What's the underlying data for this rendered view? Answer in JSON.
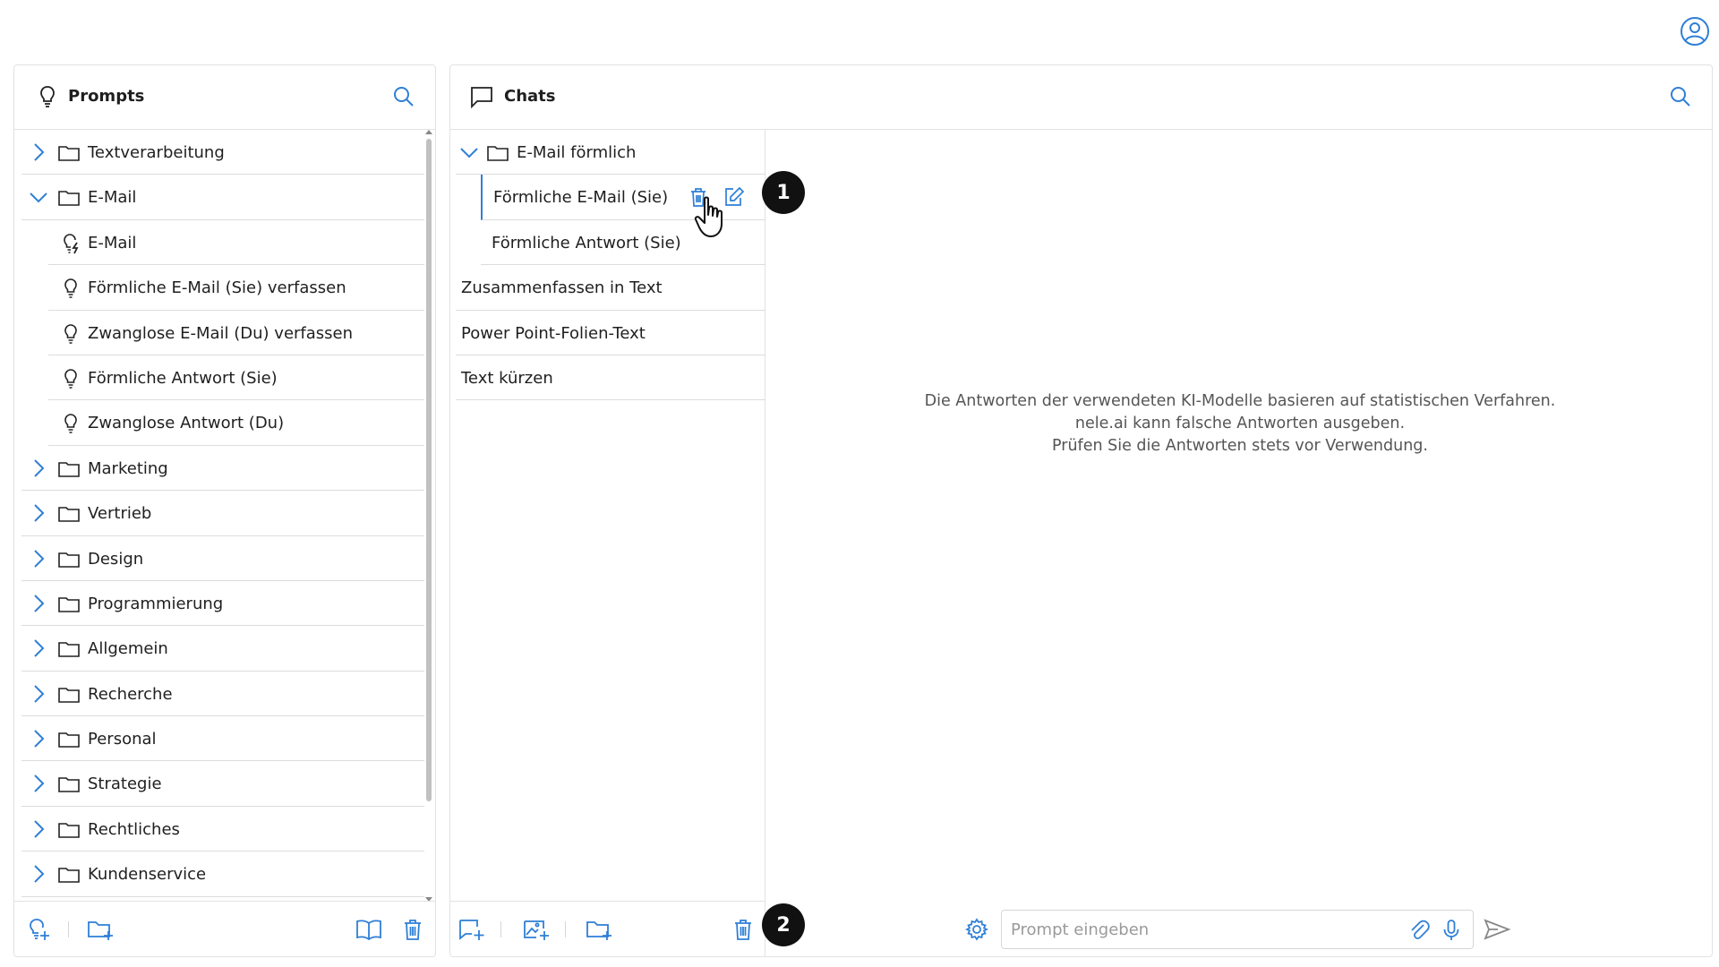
{
  "colors": {
    "accent": "#2f7fd6",
    "text": "#1f1f1f",
    "border": "#e2e2e2",
    "muted": "#555555"
  },
  "prompts": {
    "title": "Prompts",
    "tree": [
      {
        "label": "Textverarbeitung",
        "type": "folder",
        "expanded": false
      },
      {
        "label": "E-Mail",
        "type": "folder",
        "expanded": true
      },
      {
        "label": "E-Mail",
        "type": "prompt-special"
      },
      {
        "label": "Förmliche E-Mail (Sie) verfassen",
        "type": "prompt"
      },
      {
        "label": "Zwanglose E-Mail (Du) verfassen",
        "type": "prompt"
      },
      {
        "label": "Förmliche Antwort (Sie)",
        "type": "prompt"
      },
      {
        "label": "Zwanglose Antwort (Du)",
        "type": "prompt"
      },
      {
        "label": "Marketing",
        "type": "folder",
        "expanded": false
      },
      {
        "label": "Vertrieb",
        "type": "folder",
        "expanded": false
      },
      {
        "label": "Design",
        "type": "folder",
        "expanded": false
      },
      {
        "label": "Programmierung",
        "type": "folder",
        "expanded": false
      },
      {
        "label": "Allgemein",
        "type": "folder",
        "expanded": false
      },
      {
        "label": "Recherche",
        "type": "folder",
        "expanded": false
      },
      {
        "label": "Personal",
        "type": "folder",
        "expanded": false
      },
      {
        "label": "Strategie",
        "type": "folder",
        "expanded": false
      },
      {
        "label": "Rechtliches",
        "type": "folder",
        "expanded": false
      },
      {
        "label": "Kundenservice",
        "type": "folder",
        "expanded": false
      }
    ]
  },
  "chats": {
    "title": "Chats",
    "folder": {
      "label": "E-Mail förmlich"
    },
    "items": [
      {
        "label": "Förmliche E-Mail (Sie)"
      },
      {
        "label": "Förmliche Antwort (Sie)"
      },
      {
        "label": "Zusammenfassen in Text"
      },
      {
        "label": "Power Point-Folien-Text"
      },
      {
        "label": "Text kürzen"
      }
    ]
  },
  "disclaimer": {
    "line1": "Die Antworten der verwendeten KI-Modelle basieren auf statistischen Verfahren.",
    "line2": "nele.ai kann falsche Antworten ausgeben.",
    "line3": "Prüfen Sie die Antworten stets vor Verwendung."
  },
  "composer": {
    "placeholder": "Prompt eingeben"
  },
  "callouts": {
    "one": "1",
    "two": "2"
  }
}
